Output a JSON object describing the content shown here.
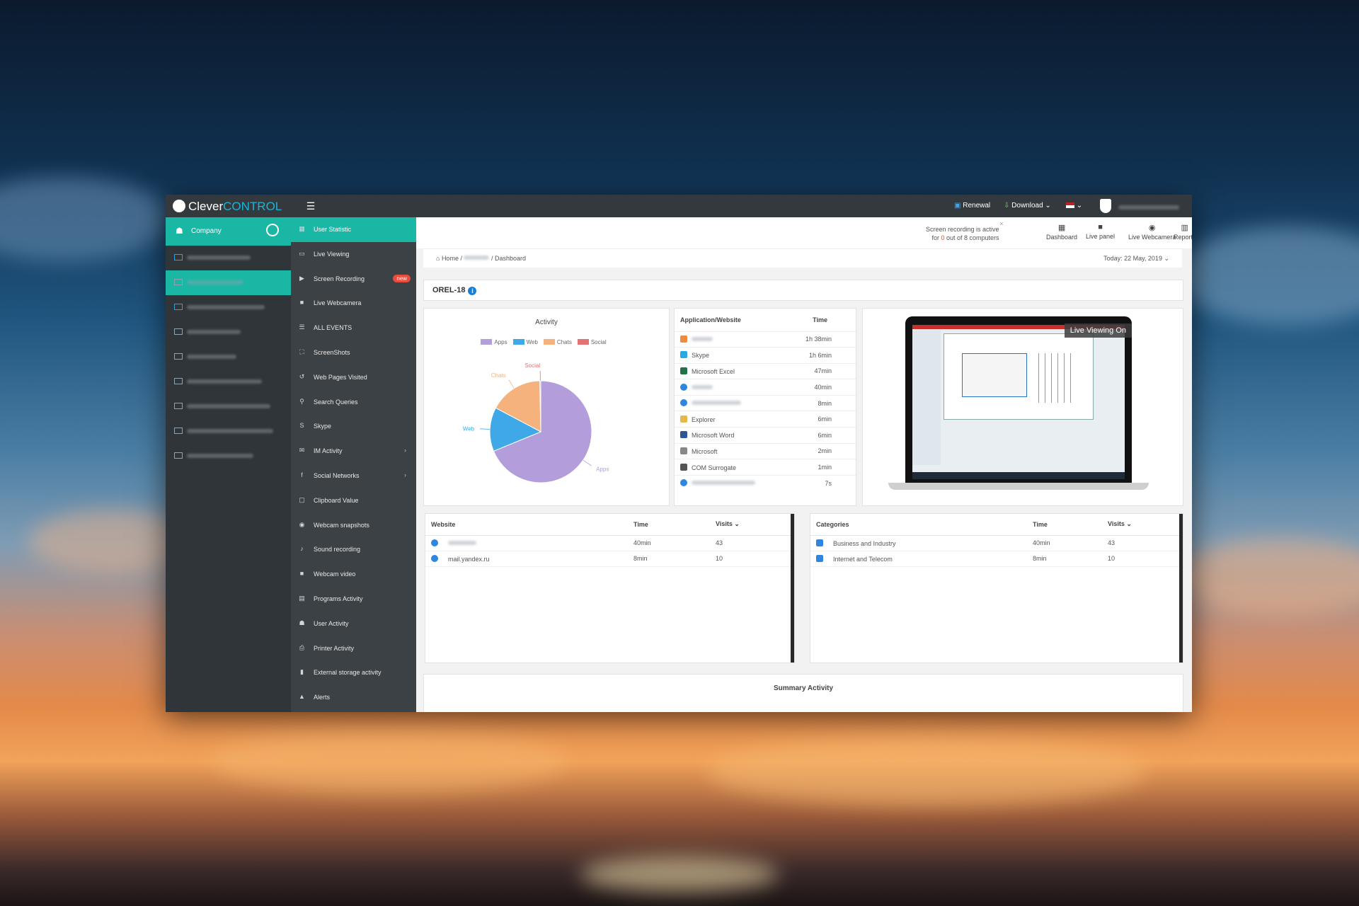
{
  "app": {
    "logo_plain": "Clever",
    "logo_accent": "CONTROL",
    "topbar": {
      "renewal": "Renewal",
      "download": "Download ⌄",
      "lang": "⌄"
    }
  },
  "sidebar": {
    "company_label": "Company",
    "computers": [
      {
        "active": false
      },
      {
        "active": true
      },
      {
        "active": false
      },
      {
        "active": false
      },
      {
        "active": false
      },
      {
        "active": false
      },
      {
        "active": false
      },
      {
        "active": false
      },
      {
        "active": false
      }
    ]
  },
  "menu": {
    "items": [
      {
        "label": "User Statistic",
        "icon": "grid-icon",
        "glyph": "▦",
        "active": true
      },
      {
        "label": "Live Viewing",
        "icon": "monitor-icon",
        "glyph": "▭"
      },
      {
        "label": "Screen Recording",
        "icon": "play-icon",
        "glyph": "▶",
        "badge": "new"
      },
      {
        "label": "Live Webcamera",
        "icon": "video-icon",
        "glyph": "■"
      },
      {
        "label": "ALL EVENTS",
        "icon": "list-icon",
        "glyph": "☰"
      },
      {
        "label": "ScreenShots",
        "icon": "crop-icon",
        "glyph": "⛶"
      },
      {
        "label": "Web Pages Visited",
        "icon": "history-icon",
        "glyph": "↺"
      },
      {
        "label": "Search Queries",
        "icon": "search-icon",
        "glyph": "⚲"
      },
      {
        "label": "Skype",
        "icon": "skype-icon",
        "glyph": "S"
      },
      {
        "label": "IM Activity",
        "icon": "chat-icon",
        "glyph": "✉",
        "arrow": "›"
      },
      {
        "label": "Social Networks",
        "icon": "social-icon",
        "glyph": "f",
        "arrow": "›"
      },
      {
        "label": "Clipboard Value",
        "icon": "clipboard-icon",
        "glyph": "▢"
      },
      {
        "label": "Webcam snapshots",
        "icon": "camera-icon",
        "glyph": "◉"
      },
      {
        "label": "Sound recording",
        "icon": "mic-icon",
        "glyph": "♪"
      },
      {
        "label": "Webcam video",
        "icon": "video-icon",
        "glyph": "■"
      },
      {
        "label": "Programs Activity",
        "icon": "calendar-icon",
        "glyph": "▤"
      },
      {
        "label": "User Activity",
        "icon": "user-icon",
        "glyph": "☗"
      },
      {
        "label": "Printer Activity",
        "icon": "printer-icon",
        "glyph": "⎙"
      },
      {
        "label": "External storage activity",
        "icon": "usb-icon",
        "glyph": "▮"
      },
      {
        "label": "Alerts",
        "icon": "alert-icon",
        "glyph": "▲"
      }
    ]
  },
  "header": {
    "rec_line1": "Screen recording is active",
    "rec_pre": "for ",
    "rec_zero": "0",
    "rec_post": " out of 8 computers",
    "nav": [
      {
        "label": "Dashboard",
        "icon": "dashboard-icon",
        "glyph": "▦"
      },
      {
        "label": "Live panel",
        "icon": "video-icon",
        "glyph": "■"
      },
      {
        "label": "Live Webcamera",
        "icon": "camera-icon",
        "glyph": "◉"
      },
      {
        "label": "Reports",
        "icon": "reports-icon",
        "glyph": "▥"
      }
    ]
  },
  "breadcrumb": {
    "home": "Home",
    "current": "Dashboard",
    "date": "Today: 22 May, 2019 ⌄"
  },
  "computer_name": "OREL-18",
  "activity": {
    "title": "Activity",
    "colors": {
      "Apps": "#b39ddb",
      "Web": "#3fa9e8",
      "Chats": "#f6b27c",
      "Social": "#e57373"
    },
    "chart_data": {
      "type": "pie",
      "title": "Activity",
      "labels": [
        "Apps",
        "Web",
        "Chats",
        "Social"
      ],
      "values": [
        69,
        14,
        17,
        0.3
      ]
    }
  },
  "apps_table": {
    "headers": [
      "Application/Website",
      "Time"
    ],
    "rows": [
      {
        "name": "",
        "time": "1h 38min",
        "icon": "app-icon",
        "color": "#f08a3c"
      },
      {
        "name": "Skype",
        "time": "1h 6min",
        "icon": "skype-icon",
        "color": "#27a9e1"
      },
      {
        "name": "Microsoft Excel",
        "time": "47min",
        "icon": "excel-icon",
        "color": "#217346"
      },
      {
        "name": "",
        "time": "40min",
        "icon": "globe-icon",
        "color": "#2e86de"
      },
      {
        "name": "",
        "time": "8min",
        "icon": "globe-icon",
        "color": "#2e86de"
      },
      {
        "name": "Explorer",
        "time": "6min",
        "icon": "folder-icon",
        "color": "#e6b84a"
      },
      {
        "name": "Microsoft Word",
        "time": "6min",
        "icon": "word-icon",
        "color": "#2b5797"
      },
      {
        "name": "Microsoft",
        "time": "2min",
        "icon": "app-icon",
        "color": "#888888"
      },
      {
        "name": "COM Surrogate",
        "time": "1min",
        "icon": "window-icon",
        "color": "#555555"
      },
      {
        "name": "",
        "time": "7s",
        "icon": "globe-icon",
        "color": "#2e86de"
      }
    ]
  },
  "live_view": {
    "label": "Live Viewing On"
  },
  "websites": {
    "headers": {
      "site": "Website",
      "time": "Time",
      "visits": "Visits ⌄"
    },
    "rows": [
      {
        "site": "",
        "time": "40min",
        "visits": "43"
      },
      {
        "site": "mail.yandex.ru",
        "time": "8min",
        "visits": "10"
      }
    ]
  },
  "categories": {
    "headers": {
      "cat": "Categories",
      "time": "Time",
      "visits": "Visits ⌄"
    },
    "rows": [
      {
        "cat": "Business and Industry",
        "time": "40min",
        "visits": "43"
      },
      {
        "cat": "Internet and Telecom",
        "time": "8min",
        "visits": "10"
      }
    ]
  },
  "summary": {
    "title": "Summary Activity"
  }
}
